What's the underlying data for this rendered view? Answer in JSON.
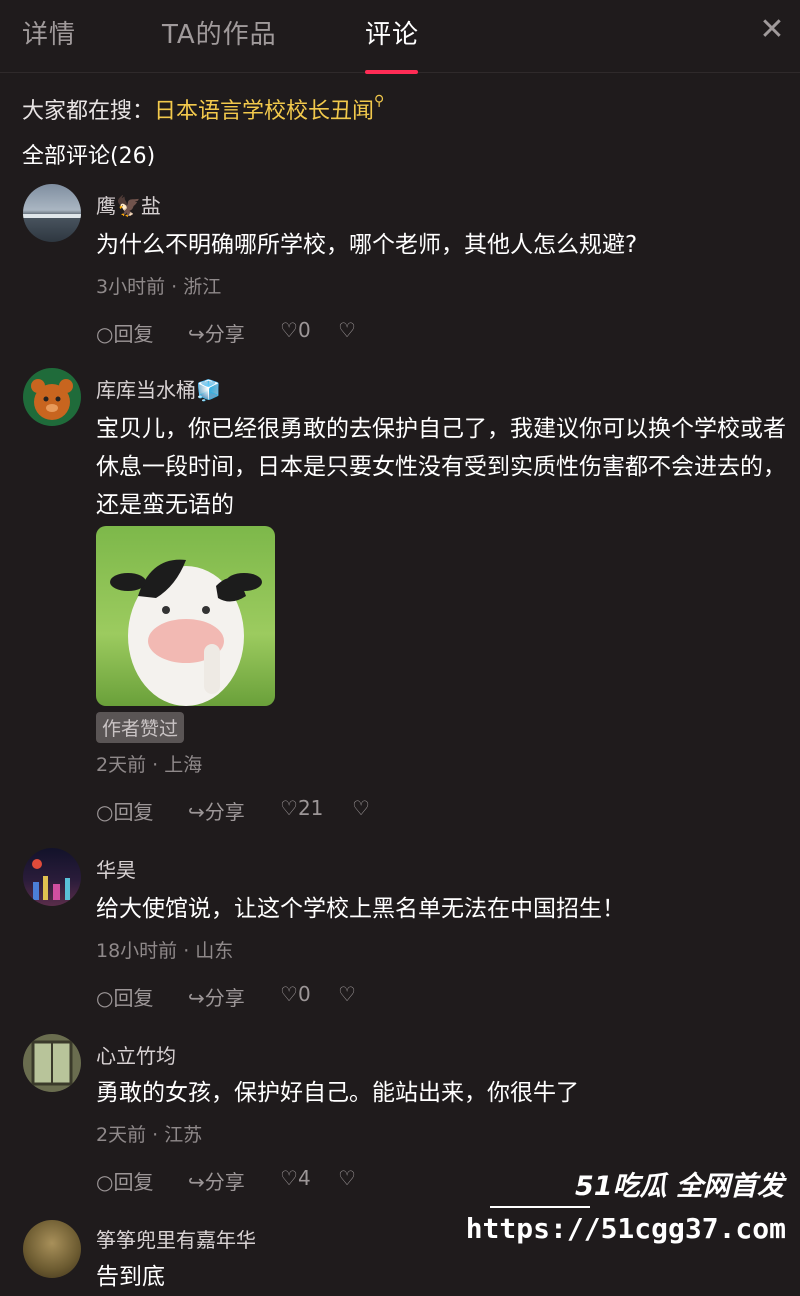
{
  "tabs": [
    {
      "label": "详情"
    },
    {
      "label": "TA的作品"
    },
    {
      "label": "评论"
    }
  ],
  "search": {
    "prefix": "大家都在搜：",
    "term": "日本语言学校校长丑闻"
  },
  "comments_count_label": "全部评论(26)",
  "action_labels": {
    "reply": "回复",
    "share": "分享"
  },
  "comments": [
    {
      "user": "鹰🦅盐",
      "text": "为什么不明确哪所学校，哪个老师，其他人怎么规避?",
      "meta": "3小时前 · 浙江",
      "likes": "0"
    },
    {
      "user": "库库当水桶🧊",
      "text": "宝贝儿，你已经很勇敢的去保护自己了，我建议你可以换个学校或者休息一段时间，日本是只要女性没有受到实质性伤害都不会进去的，还是蛮无语的",
      "badge": "作者赞过",
      "meta": "2天前 · 上海",
      "likes": "21"
    },
    {
      "user": "华昊",
      "text": "给大使馆说，让这个学校上黑名单无法在中国招生！",
      "meta": "18小时前 · 山东",
      "likes": "0"
    },
    {
      "user": "心立竹均",
      "text": "勇敢的女孩，保护好自己。能站出来，你很牛了",
      "meta": "2天前 · 江苏",
      "likes": "4"
    },
    {
      "user": "筝筝兜里有嘉年华",
      "text": "告到底"
    }
  ],
  "watermark": {
    "brand": "51吃瓜 全网首发",
    "url": "https://51cgg37.com"
  },
  "colors": {
    "background": "#1f1b1c",
    "accent": "#ff2c55",
    "search_term": "#f2c94c"
  }
}
